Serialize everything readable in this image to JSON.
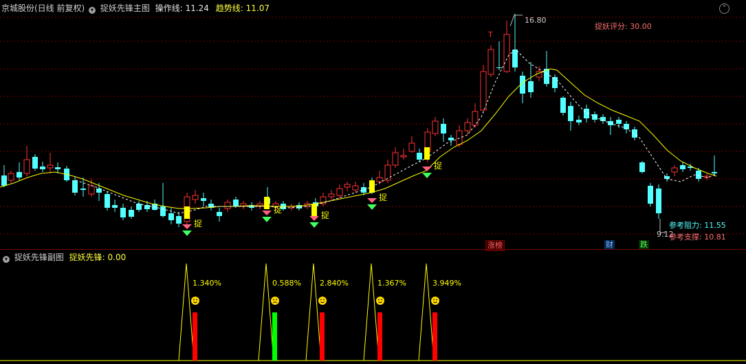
{
  "main_header": {
    "stock": "京城股份(日线 前复权)",
    "panel": "捉妖先锋主图",
    "op_label": "操作线:",
    "op_value": "11.24",
    "trend_label": "趋势线:",
    "trend_value": "11.07"
  },
  "main_panel": {
    "high_label": "16.80",
    "low_label": "9.12",
    "score_text": "捉妖评分: 30.00",
    "resistance_text": "参考阻力: 11.55",
    "support_text": "参考支撑: 10.81",
    "signal_char": "捉",
    "t_mark": "T",
    "tags": [
      "涨榜",
      "财",
      "跌"
    ]
  },
  "sub_header": {
    "panel": "捉妖先锋副图",
    "indicator_label": "捉妖先锋:",
    "indicator_value": "0.00"
  },
  "sub_panel": {
    "signals": [
      {
        "pct": "1.340%",
        "mood": "happy"
      },
      {
        "pct": "0.588%",
        "mood": "sad"
      },
      {
        "pct": "2.840%",
        "mood": "happy"
      },
      {
        "pct": "1.367%",
        "mood": "happy"
      },
      {
        "pct": "3.949%",
        "mood": "happy"
      }
    ]
  },
  "colors": {
    "up": "#ff3232",
    "down": "#54ffff",
    "trend_line": "#ffff00",
    "op_line": "#ffffff",
    "grid": "#7a0000",
    "signal_bar": "#ffff00",
    "sub_red": "#ff0000",
    "sub_green": "#00ff00"
  },
  "icons": {
    "collapse": "chevron-down-icon",
    "corner": "chevron-up-icon"
  }
}
